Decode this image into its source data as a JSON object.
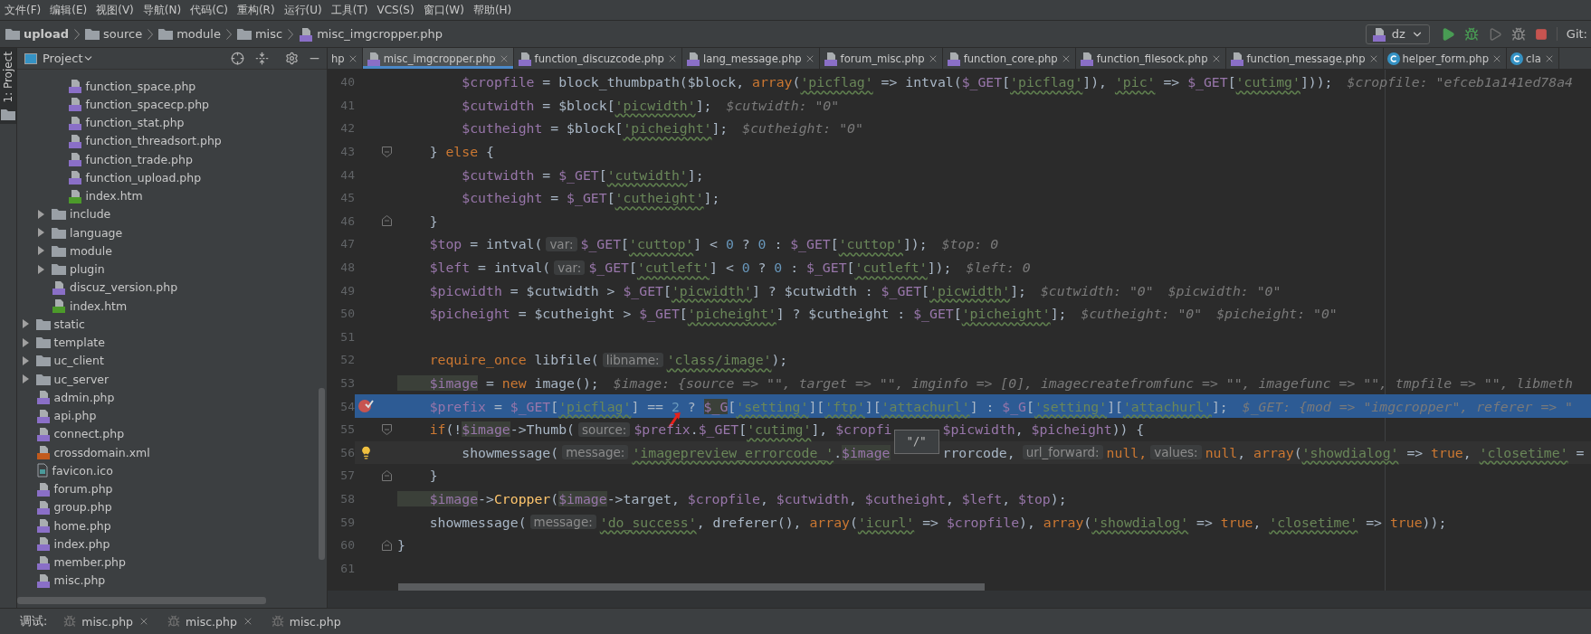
{
  "menu": [
    "文件(F)",
    "编辑(E)",
    "视图(V)",
    "导航(N)",
    "代码(C)",
    "重构(R)",
    "运行(U)",
    "工具(T)",
    "VCS(S)",
    "窗口(W)",
    "帮助(H)"
  ],
  "breadcrumb": [
    {
      "kind": "folder",
      "label": "upload"
    },
    {
      "kind": "folder",
      "label": "source"
    },
    {
      "kind": "folder",
      "label": "module"
    },
    {
      "kind": "folder",
      "label": "misc"
    },
    {
      "kind": "php",
      "label": "misc_imgcropper.php"
    }
  ],
  "toolbar": {
    "config": "dz",
    "git": "Git:"
  },
  "project_panel": {
    "title": "Project",
    "strip_label": "1: Project",
    "tree": [
      {
        "children": [
          {
            "children": [
              {
                "kind": "php",
                "name": "function_space.php"
              },
              {
                "kind": "php",
                "name": "function_spacecp.php"
              },
              {
                "kind": "php",
                "name": "function_stat.php"
              },
              {
                "kind": "php",
                "name": "function_threadsort.php"
              },
              {
                "kind": "php",
                "name": "function_trade.php"
              },
              {
                "kind": "php",
                "name": "function_upload.php"
              },
              {
                "kind": "htm",
                "name": "index.htm"
              }
            ]
          },
          {
            "kind": "folder",
            "name": "include",
            "expanded": false
          },
          {
            "kind": "folder",
            "name": "language",
            "expanded": false
          },
          {
            "kind": "folder",
            "name": "module",
            "expanded": false
          },
          {
            "kind": "folder",
            "name": "plugin",
            "expanded": false
          },
          {
            "kind": "php",
            "name": "discuz_version.php"
          },
          {
            "kind": "htm",
            "name": "index.htm"
          }
        ]
      },
      {
        "kind": "folder",
        "name": "static",
        "expanded": false
      },
      {
        "kind": "folder",
        "name": "template",
        "expanded": false
      },
      {
        "kind": "folder",
        "name": "uc_client",
        "expanded": false
      },
      {
        "kind": "folder",
        "name": "uc_server",
        "expanded": false
      },
      {
        "kind": "php",
        "name": "admin.php"
      },
      {
        "kind": "php",
        "name": "api.php"
      },
      {
        "kind": "php",
        "name": "connect.php"
      },
      {
        "kind": "xml",
        "name": "crossdomain.xml"
      },
      {
        "kind": "ico",
        "name": "favicon.ico"
      },
      {
        "kind": "php",
        "name": "forum.php"
      },
      {
        "kind": "php",
        "name": "group.php"
      },
      {
        "kind": "php",
        "name": "home.php"
      },
      {
        "kind": "php",
        "name": "index.php"
      },
      {
        "kind": "php",
        "name": "member.php"
      },
      {
        "kind": "php",
        "name": "misc.php"
      }
    ]
  },
  "tabs": [
    {
      "kind": "none",
      "label": "hp",
      "selected": false
    },
    {
      "kind": "php",
      "label": "misc_imgcropper.php",
      "selected": true
    },
    {
      "kind": "php",
      "label": "function_discuzcode.php",
      "selected": false
    },
    {
      "kind": "php",
      "label": "lang_message.php",
      "selected": false
    },
    {
      "kind": "php",
      "label": "forum_misc.php",
      "selected": false
    },
    {
      "kind": "php",
      "label": "function_core.php",
      "selected": false
    },
    {
      "kind": "php",
      "label": "function_filesock.php",
      "selected": false
    },
    {
      "kind": "php",
      "label": "function_message.php",
      "selected": false
    },
    {
      "kind": "class",
      "label": "helper_form.php",
      "selected": false
    },
    {
      "kind": "class",
      "label": "cla",
      "selected": false
    }
  ],
  "code_lines": [
    {
      "number": "40",
      "tokens": [
        {
          "kind": "var",
          "text": "        $cropfile"
        },
        {
          "kind": "plain",
          "text": " = block_thumbpath($block, "
        },
        {
          "kind": "kw",
          "text": "array"
        },
        {
          "kind": "plain",
          "text": "("
        },
        {
          "kind": "str",
          "text": "'picflag'"
        },
        {
          "kind": "plain",
          "text": " => intval("
        },
        {
          "kind": "var",
          "text": "$_GET"
        },
        {
          "kind": "plain",
          "text": "["
        },
        {
          "kind": "str",
          "text": "'picflag'"
        },
        {
          "kind": "plain",
          "text": "]), "
        },
        {
          "kind": "str",
          "text": "'pic'"
        },
        {
          "kind": "plain",
          "text": " => "
        },
        {
          "kind": "var",
          "text": "$_GET"
        },
        {
          "kind": "plain",
          "text": "["
        },
        {
          "kind": "str",
          "text": "'cutimg'"
        },
        {
          "kind": "plain",
          "text": "]));"
        },
        {
          "kind": "hint",
          "text": "$cropfile: \"efceb1a141ed78a4"
        }
      ]
    },
    {
      "number": "41",
      "tokens": [
        {
          "kind": "var",
          "text": "        $cutwidth"
        },
        {
          "kind": "plain",
          "text": " = $block["
        },
        {
          "kind": "str",
          "text": "'picwidth'"
        },
        {
          "kind": "plain",
          "text": "];"
        },
        {
          "kind": "hint",
          "text": "$cutwidth: \"0\""
        }
      ]
    },
    {
      "number": "42",
      "tokens": [
        {
          "kind": "var",
          "text": "        $cutheight"
        },
        {
          "kind": "plain",
          "text": " = $block["
        },
        {
          "kind": "str",
          "text": "'picheight'"
        },
        {
          "kind": "plain",
          "text": "];"
        },
        {
          "kind": "hint",
          "text": "$cutheight: \"0\""
        }
      ]
    },
    {
      "number": "43",
      "fold_open": true,
      "tokens": [
        {
          "kind": "plain",
          "text": "    } "
        },
        {
          "kind": "kw",
          "text": "else"
        },
        {
          "kind": "plain",
          "text": " {"
        }
      ]
    },
    {
      "number": "44",
      "tokens": [
        {
          "kind": "var",
          "text": "        $cutwidth"
        },
        {
          "kind": "plain",
          "text": " = "
        },
        {
          "kind": "var",
          "text": "$_GET"
        },
        {
          "kind": "plain",
          "text": "["
        },
        {
          "kind": "str",
          "text": "'cutwidth'"
        },
        {
          "kind": "plain",
          "text": "];"
        }
      ]
    },
    {
      "number": "45",
      "tokens": [
        {
          "kind": "var",
          "text": "        $cutheight"
        },
        {
          "kind": "plain",
          "text": " = "
        },
        {
          "kind": "var",
          "text": "$_GET"
        },
        {
          "kind": "plain",
          "text": "["
        },
        {
          "kind": "str",
          "text": "'cutheight'"
        },
        {
          "kind": "plain",
          "text": "];"
        }
      ]
    },
    {
      "number": "46",
      "fold_close": true,
      "tokens": [
        {
          "kind": "plain",
          "text": "    }"
        }
      ]
    },
    {
      "number": "47",
      "tokens": [
        {
          "kind": "var",
          "text": "    $top"
        },
        {
          "kind": "plain",
          "text": " = intval("
        },
        {
          "kind": "param",
          "text": "var:"
        },
        {
          "kind": "var",
          "text": "$_GET"
        },
        {
          "kind": "plain",
          "text": "["
        },
        {
          "kind": "str",
          "text": "'cuttop'"
        },
        {
          "kind": "plain",
          "text": "] < "
        },
        {
          "kind": "num",
          "text": "0"
        },
        {
          "kind": "plain",
          "text": " ? "
        },
        {
          "kind": "num",
          "text": "0"
        },
        {
          "kind": "plain",
          "text": " : "
        },
        {
          "kind": "var",
          "text": "$_GET"
        },
        {
          "kind": "plain",
          "text": "["
        },
        {
          "kind": "str",
          "text": "'cuttop'"
        },
        {
          "kind": "plain",
          "text": "]);"
        },
        {
          "kind": "hint",
          "text": "$top: 0"
        }
      ]
    },
    {
      "number": "48",
      "tokens": [
        {
          "kind": "var",
          "text": "    $left"
        },
        {
          "kind": "plain",
          "text": " = intval("
        },
        {
          "kind": "param",
          "text": "var:"
        },
        {
          "kind": "var",
          "text": "$_GET"
        },
        {
          "kind": "plain",
          "text": "["
        },
        {
          "kind": "str",
          "text": "'cutleft'"
        },
        {
          "kind": "plain",
          "text": "] < "
        },
        {
          "kind": "num",
          "text": "0"
        },
        {
          "kind": "plain",
          "text": " ? "
        },
        {
          "kind": "num",
          "text": "0"
        },
        {
          "kind": "plain",
          "text": " : "
        },
        {
          "kind": "var",
          "text": "$_GET"
        },
        {
          "kind": "plain",
          "text": "["
        },
        {
          "kind": "str",
          "text": "'cutleft'"
        },
        {
          "kind": "plain",
          "text": "]);"
        },
        {
          "kind": "hint",
          "text": "$left: 0"
        }
      ]
    },
    {
      "number": "49",
      "tokens": [
        {
          "kind": "var",
          "text": "    $picwidth"
        },
        {
          "kind": "plain",
          "text": " = $cutwidth > "
        },
        {
          "kind": "var",
          "text": "$_GET"
        },
        {
          "kind": "plain",
          "text": "["
        },
        {
          "kind": "str",
          "text": "'picwidth'"
        },
        {
          "kind": "plain",
          "text": "] ? $cutwidth : "
        },
        {
          "kind": "var",
          "text": "$_GET"
        },
        {
          "kind": "plain",
          "text": "["
        },
        {
          "kind": "str",
          "text": "'picwidth'"
        },
        {
          "kind": "plain",
          "text": "];"
        },
        {
          "kind": "hint",
          "text": "$cutwidth: \"0\""
        },
        {
          "kind": "hint",
          "text": "$picwidth: \"0\""
        }
      ]
    },
    {
      "number": "50",
      "tokens": [
        {
          "kind": "var",
          "text": "    $picheight"
        },
        {
          "kind": "plain",
          "text": " = $cutheight > "
        },
        {
          "kind": "var",
          "text": "$_GET"
        },
        {
          "kind": "plain",
          "text": "["
        },
        {
          "kind": "str",
          "text": "'picheight'"
        },
        {
          "kind": "plain",
          "text": "] ? $cutheight : "
        },
        {
          "kind": "var",
          "text": "$_GET"
        },
        {
          "kind": "plain",
          "text": "["
        },
        {
          "kind": "str",
          "text": "'picheight'"
        },
        {
          "kind": "plain",
          "text": "];"
        },
        {
          "kind": "hint",
          "text": "$cutheight: \"0\""
        },
        {
          "kind": "hint",
          "text": "$picheight: \"0\""
        }
      ]
    },
    {
      "number": "51"
    },
    {
      "number": "52",
      "tokens": [
        {
          "kind": "kw",
          "text": "    require_once"
        },
        {
          "kind": "plain",
          "text": " libfile("
        },
        {
          "kind": "param",
          "text": "libname:"
        },
        {
          "kind": "str",
          "text": "'class/image'"
        },
        {
          "kind": "plain",
          "text": ");"
        }
      ]
    },
    {
      "number": "53",
      "tokens": [
        {
          "kind": "varhl",
          "text": "    $image"
        },
        {
          "kind": "plain",
          "text": " = "
        },
        {
          "kind": "kw",
          "text": "new"
        },
        {
          "kind": "plain",
          "text": " image();"
        },
        {
          "kind": "hint",
          "text": "$image: {source => \"\", target => \"\", imginfo => [0], imagecreatefromfunc => \"\", imagefunc => \"\", tmpfile => \"\", libmeth"
        }
      ]
    },
    {
      "number": "54",
      "current": true,
      "breakpoint": true,
      "tokens": [
        {
          "kind": "var",
          "text": "    $prefix"
        },
        {
          "kind": "plain",
          "text": " = "
        },
        {
          "kind": "var",
          "text": "$_GET"
        },
        {
          "kind": "plain",
          "text": "["
        },
        {
          "kind": "str",
          "text": "'picflag'"
        },
        {
          "kind": "plain",
          "text": "] == "
        },
        {
          "kind": "num",
          "text": "2",
          "arrow": true
        },
        {
          "kind": "plain",
          "text": " ? "
        },
        {
          "kind": "varhl",
          "text": "$_G"
        },
        {
          "kind": "plain",
          "text": "["
        },
        {
          "kind": "str",
          "text": "'setting'"
        },
        {
          "kind": "plain",
          "text": "]["
        },
        {
          "kind": "str",
          "text": "'ftp'"
        },
        {
          "kind": "plain",
          "text": "]["
        },
        {
          "kind": "str",
          "text": "'attachurl'"
        },
        {
          "kind": "plain",
          "text": "] : "
        },
        {
          "kind": "var",
          "text": "$_G"
        },
        {
          "kind": "plain",
          "text": "["
        },
        {
          "kind": "str",
          "text": "'setting'"
        },
        {
          "kind": "plain",
          "text": "]["
        },
        {
          "kind": "str",
          "text": "'attachurl'"
        },
        {
          "kind": "plain",
          "text": "];"
        },
        {
          "kind": "hint",
          "text": "$_GET: {mod => \"imgcropper\", referer => \""
        }
      ]
    },
    {
      "number": "55",
      "fold_open": true,
      "tokens": [
        {
          "kind": "kw",
          "text": "    if"
        },
        {
          "kind": "plain",
          "text": "(!"
        },
        {
          "kind": "varhl",
          "text": "$image"
        },
        {
          "kind": "plain",
          "text": "->Thumb("
        },
        {
          "kind": "param",
          "text": "source:"
        },
        {
          "kind": "var",
          "text": "$prefix"
        },
        {
          "kind": "plain",
          "text": "."
        },
        {
          "kind": "var",
          "text": "$_GET"
        },
        {
          "kind": "plain",
          "text": "["
        },
        {
          "kind": "str",
          "text": "'cutimg'"
        },
        {
          "kind": "plain",
          "text": "], "
        },
        {
          "kind": "var",
          "text": "$cropfi"
        },
        {
          "kind": "tip",
          "text": "\"/\""
        },
        {
          "kind": "var",
          "text": "$picwidth"
        },
        {
          "kind": "plain",
          "text": ", "
        },
        {
          "kind": "var",
          "text": "$picheight"
        },
        {
          "kind": "plain",
          "text": ")) {"
        }
      ]
    },
    {
      "number": "56",
      "caret": true,
      "bulb": true,
      "tokens": [
        {
          "kind": "plain",
          "text": "        showmessage("
        },
        {
          "kind": "param",
          "text": "message:"
        },
        {
          "kind": "str",
          "text": "'imagepreview_errorcode_'"
        },
        {
          "kind": "plain",
          "text": "."
        },
        {
          "kind": "varhl",
          "text": "$image"
        },
        {
          "kind": "tail",
          "text": "rrorcode,"
        },
        {
          "kind": "param",
          "text": "url_forward:"
        },
        {
          "kind": "kw",
          "text": "null,"
        },
        {
          "kind": "param",
          "text": "values:"
        },
        {
          "kind": "kw",
          "text": "null"
        },
        {
          "kind": "plain",
          "text": ", "
        },
        {
          "kind": "kw",
          "text": "array"
        },
        {
          "kind": "plain",
          "text": "("
        },
        {
          "kind": "str",
          "text": "'showdialog'"
        },
        {
          "kind": "plain",
          "text": " => "
        },
        {
          "kind": "kw",
          "text": "true"
        },
        {
          "kind": "plain",
          "text": ", "
        },
        {
          "kind": "str",
          "text": "'closetime'"
        },
        {
          "kind": "plain",
          "text": " ="
        }
      ]
    },
    {
      "number": "57",
      "fold_close": true,
      "tokens": [
        {
          "kind": "plain",
          "text": "    }"
        }
      ]
    },
    {
      "number": "58",
      "tokens": [
        {
          "kind": "varhl",
          "text": "    $image"
        },
        {
          "kind": "plain",
          "text": "->"
        },
        {
          "kind": "call",
          "text": "Cropper"
        },
        {
          "kind": "plain",
          "text": "("
        },
        {
          "kind": "varhl",
          "text": "$image"
        },
        {
          "kind": "plain",
          "text": "->target, "
        },
        {
          "kind": "var",
          "text": "$cropfile"
        },
        {
          "kind": "plain",
          "text": ", "
        },
        {
          "kind": "var",
          "text": "$cutwidth"
        },
        {
          "kind": "plain",
          "text": ", "
        },
        {
          "kind": "var",
          "text": "$cutheight"
        },
        {
          "kind": "plain",
          "text": ", "
        },
        {
          "kind": "var",
          "text": "$left"
        },
        {
          "kind": "plain",
          "text": ", "
        },
        {
          "kind": "var",
          "text": "$top"
        },
        {
          "kind": "plain",
          "text": ");"
        }
      ]
    },
    {
      "number": "59",
      "tokens": [
        {
          "kind": "plain",
          "text": "    showmessage("
        },
        {
          "kind": "param",
          "text": "message:"
        },
        {
          "kind": "str",
          "text": "'do_success'"
        },
        {
          "kind": "plain",
          "text": ", dreferer(), "
        },
        {
          "kind": "kw",
          "text": "array"
        },
        {
          "kind": "plain",
          "text": "("
        },
        {
          "kind": "str",
          "text": "'icurl'"
        },
        {
          "kind": "plain",
          "text": " => "
        },
        {
          "kind": "var",
          "text": "$cropfile"
        },
        {
          "kind": "plain",
          "text": "), "
        },
        {
          "kind": "kw",
          "text": "array"
        },
        {
          "kind": "plain",
          "text": "("
        },
        {
          "kind": "str",
          "text": "'showdialog'"
        },
        {
          "kind": "plain",
          "text": " => "
        },
        {
          "kind": "kw",
          "text": "true"
        },
        {
          "kind": "plain",
          "text": ", "
        },
        {
          "kind": "str",
          "text": "'closetime'"
        },
        {
          "kind": "plain",
          "text": " => "
        },
        {
          "kind": "kw",
          "text": "true"
        },
        {
          "kind": "plain",
          "text": "));"
        }
      ]
    },
    {
      "number": "60",
      "fold_close": true,
      "tokens": [
        {
          "kind": "plain",
          "text": "}"
        }
      ]
    },
    {
      "number": "61"
    }
  ],
  "debug_bar": {
    "label": "调试:",
    "tabs": [
      {
        "label": "misc.php",
        "closable": true
      },
      {
        "label": "misc.php",
        "closable": true
      },
      {
        "label": "misc.php",
        "closable": false
      }
    ]
  }
}
